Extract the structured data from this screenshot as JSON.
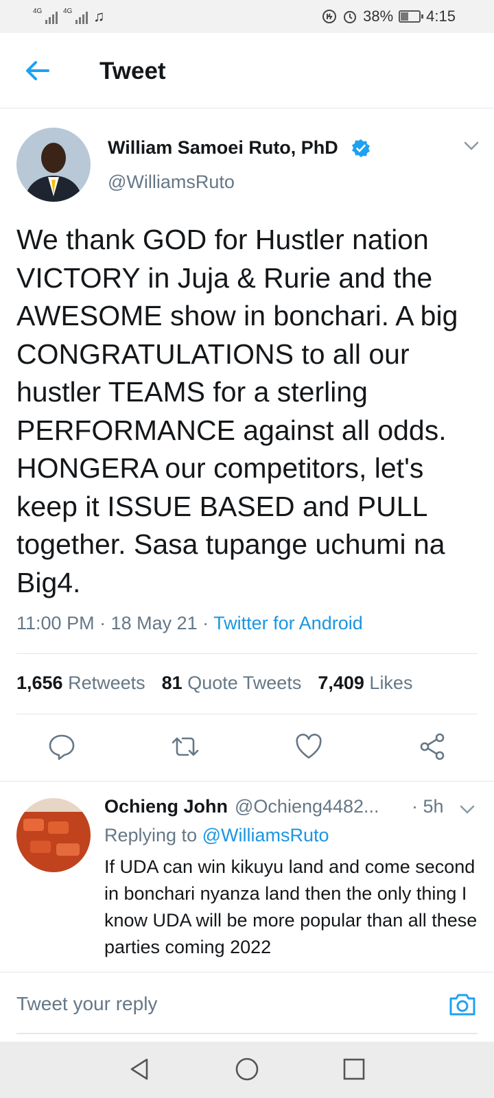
{
  "status_bar": {
    "network_left": "4G",
    "network_right": "4G",
    "battery": "38%",
    "time": "4:15"
  },
  "header": {
    "title": "Tweet"
  },
  "tweet": {
    "author_name": "William Samoei Ruto, PhD",
    "author_handle": "@WilliamsRuto",
    "text": "We thank GOD for Hustler nation VICTORY in Juja & Rurie and the AWESOME show in bonchari. A big CONGRATULATIONS to all our hustler TEAMS for a sterling PERFORMANCE against all odds. HONGERA our competitors, let's keep it ISSUE BASED and PULL together. Sasa tupange uchumi na Big4.",
    "time": "11:00 PM · 18 May 21 · ",
    "source": "Twitter for Android",
    "stats": {
      "retweets_count": "1,656",
      "retweets_label": "Retweets",
      "quotes_count": "81",
      "quotes_label": "Quote Tweets",
      "likes_count": "7,409",
      "likes_label": "Likes"
    }
  },
  "reply": {
    "name": "Ochieng John",
    "handle": "@Ochieng4482...",
    "time": "· 5h",
    "replying_label": "Replying to ",
    "replying_handle": "@WilliamsRuto",
    "text": "If UDA can win kikuyu land and come second in bonchari nyanza land then the only thing I know UDA will be more popular than all these parties coming 2022"
  },
  "compose": {
    "placeholder": "Tweet your reply"
  },
  "colors": {
    "accent": "#1da1f2",
    "link": "#1b95e0",
    "secondary_text": "#657786",
    "divider": "#e1e8ed"
  }
}
